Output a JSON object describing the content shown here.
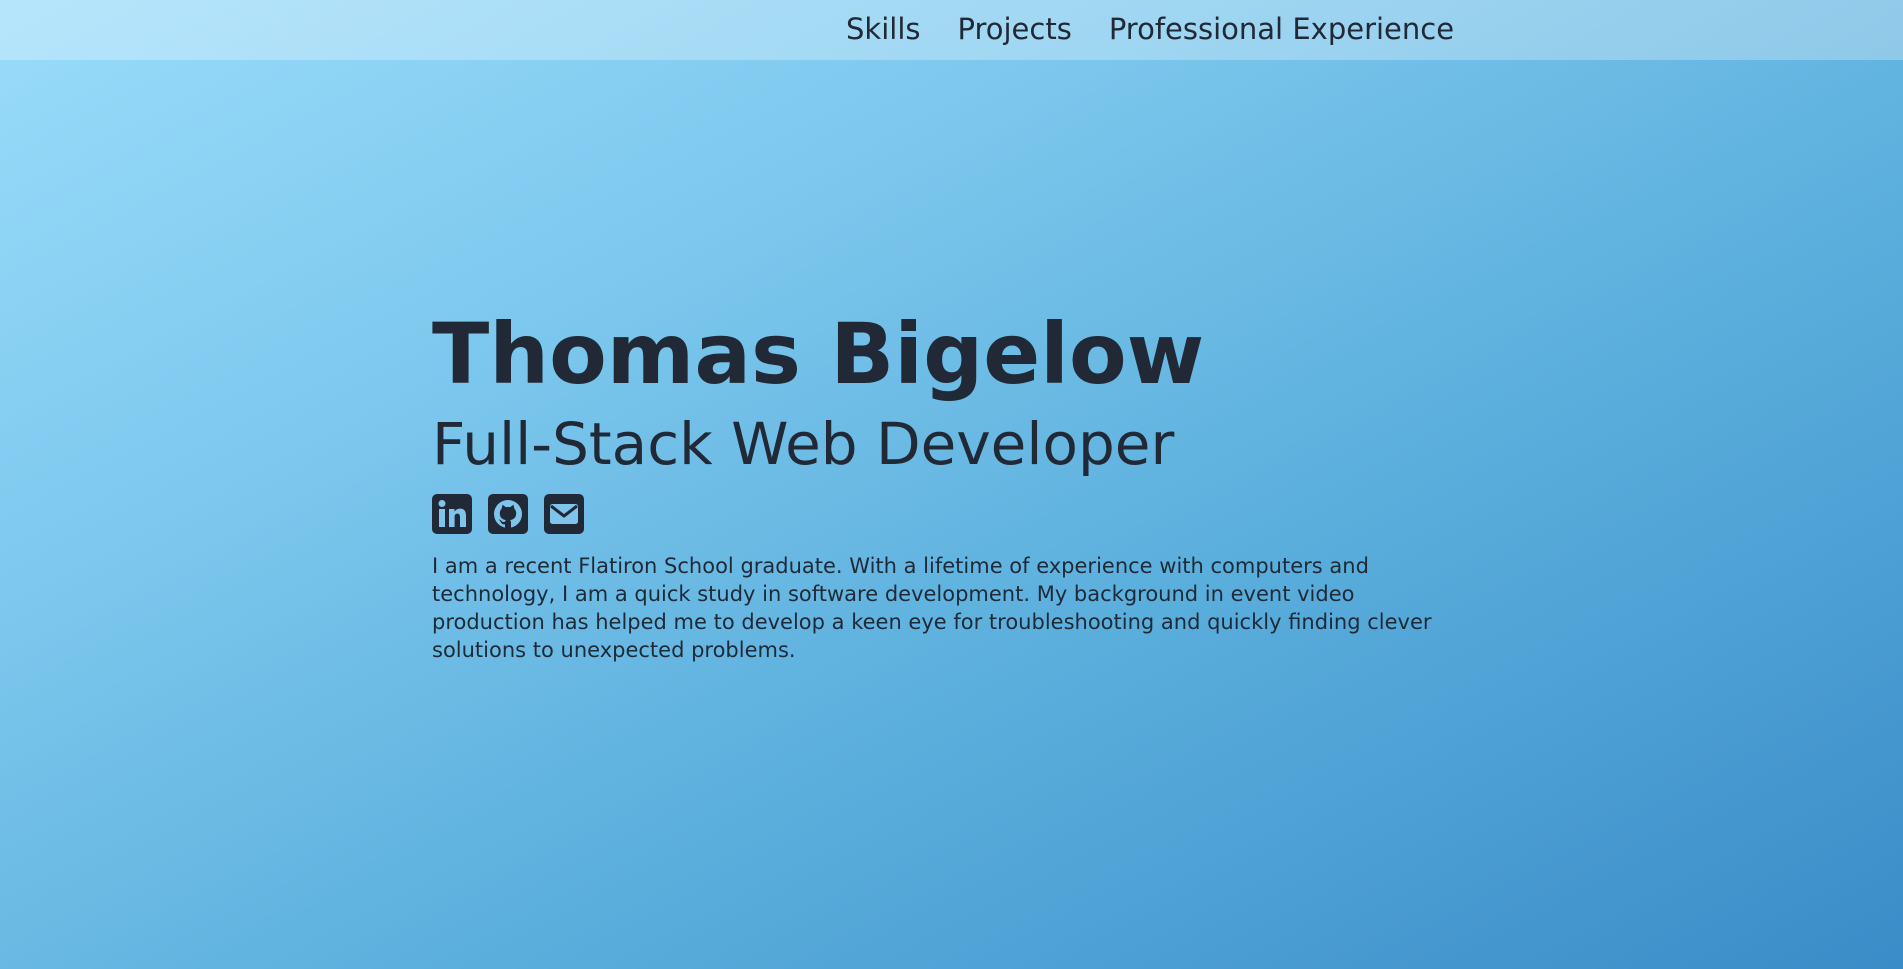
{
  "nav": {
    "items": [
      {
        "label": "Skills"
      },
      {
        "label": "Projects"
      },
      {
        "label": "Professional Experience"
      }
    ]
  },
  "hero": {
    "name": "Thomas Bigelow",
    "title": "Full-Stack Web Developer",
    "bio": "I am a recent Flatiron School graduate. With a lifetime of experience with computers and technology, I am a quick study in software development. My background in event video production has helped me to develop a keen eye for troubleshooting and quickly finding clever solutions to unexpected problems."
  },
  "social": {
    "icons": [
      "linkedin-icon",
      "github-icon",
      "email-icon"
    ]
  },
  "colors": {
    "text": "#212936",
    "background_start": "#9adcfa",
    "background_end": "#3a8cc8"
  }
}
